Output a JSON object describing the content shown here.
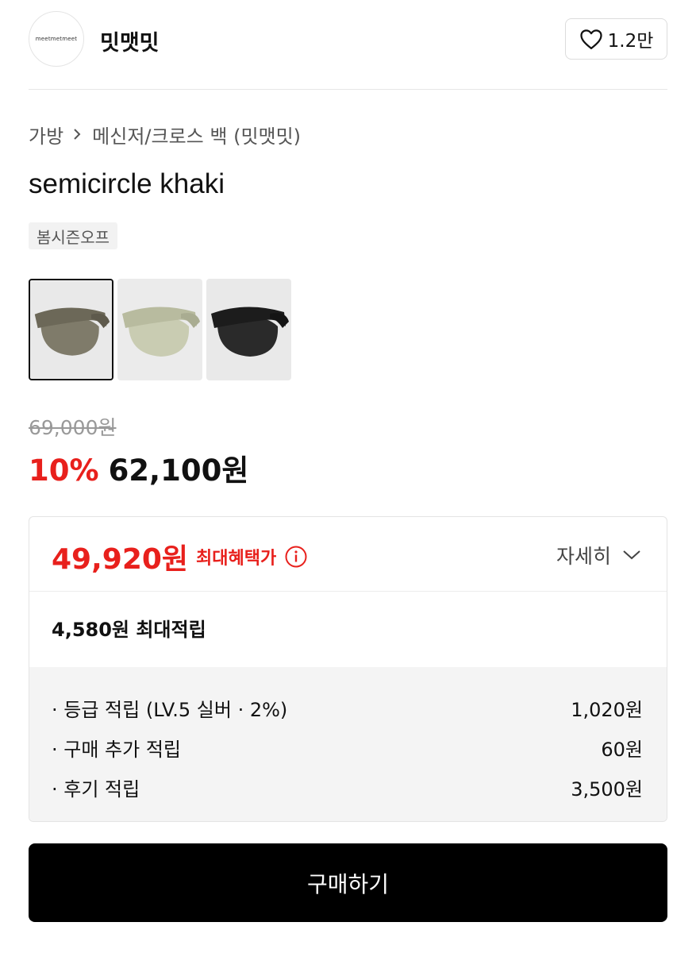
{
  "header": {
    "logo_text": "meetmetmeet",
    "brand_name": "밋맷밋",
    "like_count": "1.2만"
  },
  "breadcrumb": {
    "category": "가방",
    "subcategory": "메신저/크로스 백 (밋맷밋)"
  },
  "product": {
    "title": "semicircle khaki",
    "tag": "봄시즌오프",
    "thumbnails": [
      {
        "color_name": "khaki",
        "color": "#7f7b6a",
        "selected": true
      },
      {
        "color_name": "light green",
        "color": "#c9ccb2",
        "selected": false
      },
      {
        "color_name": "black",
        "color": "#2a2a2a",
        "selected": false
      }
    ],
    "original_price": "69,000원",
    "discount_rate": "10%",
    "sale_price": "62,100원"
  },
  "benefit": {
    "max_benefit_price": "49,920원",
    "max_benefit_label": "최대혜택가",
    "detail_label": "자세히",
    "max_points": "4,580원 최대적립",
    "point_items": [
      {
        "label": "· 등급 적립 (LV.5 실버 · 2%)",
        "value": "1,020원"
      },
      {
        "label": "· 구매 추가 적립",
        "value": "60원"
      },
      {
        "label": "· 후기 적립",
        "value": "3,500원"
      }
    ]
  },
  "buy_button_label": "구매하기",
  "colors": {
    "accent_red": "#e8201c",
    "button_black": "#000000",
    "muted_gray": "#999999"
  }
}
